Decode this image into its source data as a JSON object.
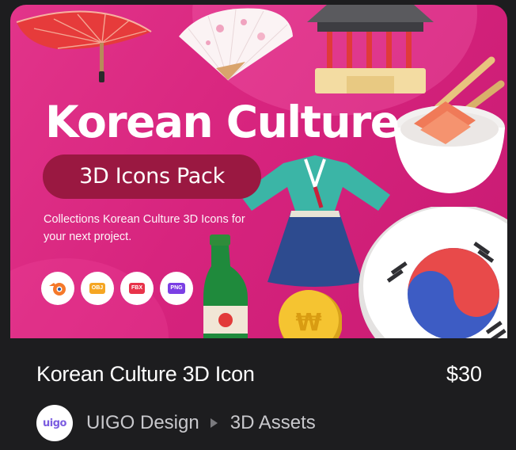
{
  "preview": {
    "hero_title": "Korean Culture",
    "pill_text": "3D Icons Pack",
    "description": "Collections Korean Culture 3D Icons for your next project.",
    "badges": [
      {
        "icon": "blender-icon",
        "label": "",
        "color": "#f5792a"
      },
      {
        "icon": "obj-file-icon",
        "label": "OBJ",
        "color": "#f5a623"
      },
      {
        "icon": "fbx-file-icon",
        "label": "FBX",
        "color": "#e8334a"
      },
      {
        "icon": "png-file-icon",
        "label": "PNG",
        "color": "#7b3fe4"
      }
    ],
    "coin_symbol": "₩",
    "background_color": "#d7247e"
  },
  "product": {
    "title": "Korean Culture 3D Icon",
    "price": "$30"
  },
  "meta": {
    "avatar_text": "uigo",
    "author": "UIGO Design",
    "category": "3D Assets"
  }
}
